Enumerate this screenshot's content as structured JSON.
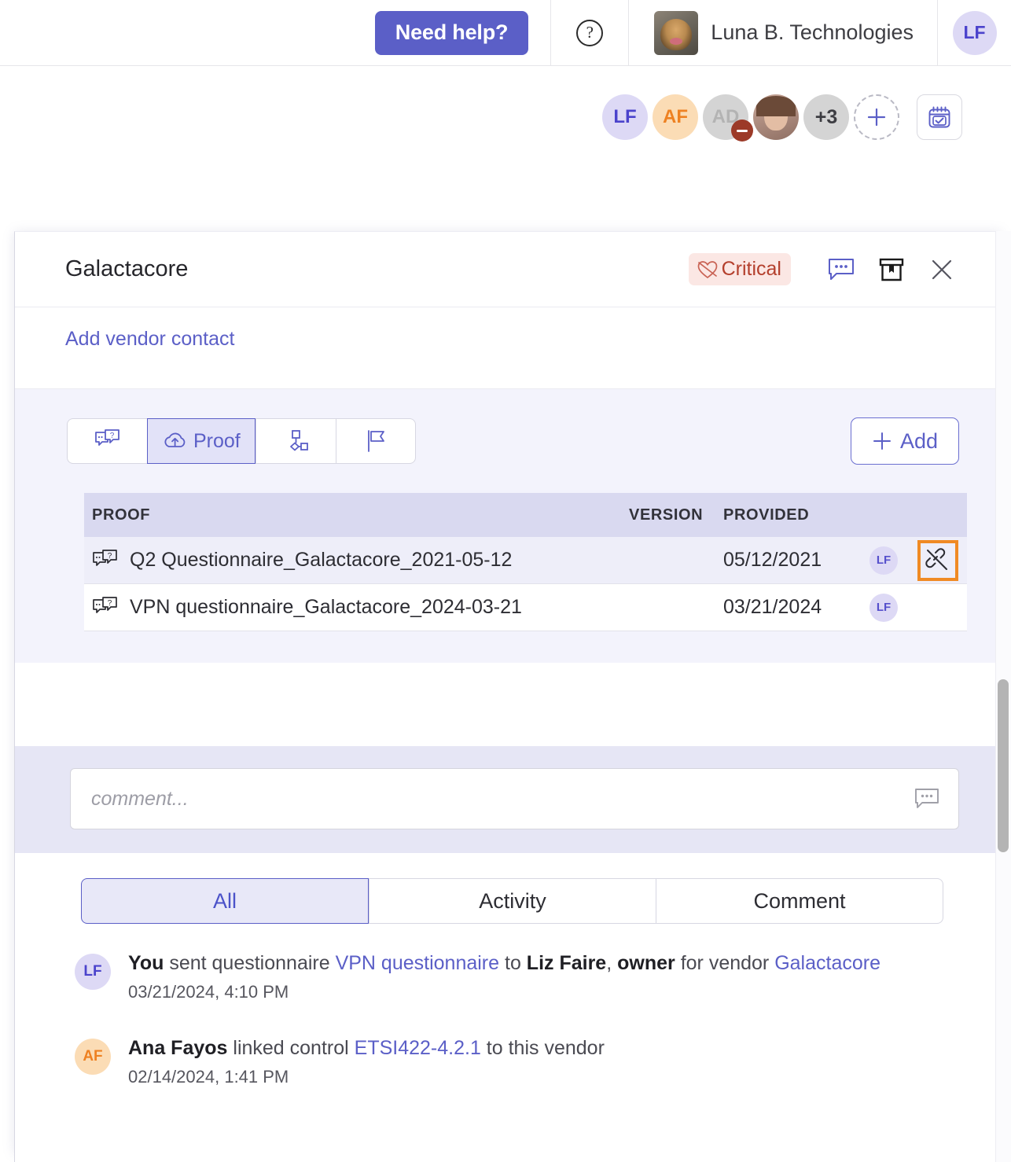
{
  "topbar": {
    "need_help_label": "Need help?",
    "help_icon": "question-circle-icon",
    "org_name": "Luna B. Technologies",
    "user_initials": "LF"
  },
  "assignees": {
    "items": [
      {
        "initials": "LF",
        "type": "initials"
      },
      {
        "initials": "AF",
        "type": "initials"
      },
      {
        "initials": "AD",
        "type": "initials",
        "badge": "minus"
      },
      {
        "initials": "",
        "type": "photo"
      },
      {
        "initials": "+3",
        "type": "overflow"
      }
    ],
    "add_label": "+",
    "calendar_button_icon": "calendar-check-icon"
  },
  "panel": {
    "title": "Galactacore",
    "badge": {
      "label": "Critical",
      "icon": "broken-heart-icon",
      "color": "#b43f2c",
      "bg": "#fbe7e4"
    },
    "actions": [
      {
        "name": "comment-icon"
      },
      {
        "name": "archive-icon"
      },
      {
        "name": "close-icon"
      }
    ],
    "add_vendor_contact": "Add vendor contact"
  },
  "proof": {
    "tabs": [
      {
        "id": "questionnaire",
        "icon": "questionnaire-icon",
        "label": "",
        "active": false
      },
      {
        "id": "proof",
        "icon": "cloud-upload-icon",
        "label": "Proof",
        "active": true
      },
      {
        "id": "workflow",
        "icon": "hierarchy-icon",
        "label": "",
        "active": false
      },
      {
        "id": "flag",
        "icon": "flag-icon",
        "label": "",
        "active": false
      }
    ],
    "add_button": {
      "label": "Add",
      "icon": "plus-icon"
    },
    "columns": [
      "PROOF",
      "VERSION",
      "PROVIDED",
      "",
      ""
    ],
    "rows": [
      {
        "name": "Q2 Questionnaire_Galactacore_2021-05-12",
        "version": "",
        "provided": "05/12/2021",
        "avatar": "LF",
        "action_icon": "unlink-icon",
        "highlighted": true,
        "selected": true
      },
      {
        "name": "VPN questionnaire_Galactacore_2024-03-21",
        "version": "",
        "provided": "03/21/2024",
        "avatar": "LF",
        "action_icon": "",
        "highlighted": false,
        "selected": false
      }
    ]
  },
  "comment": {
    "placeholder": "comment...",
    "value": "",
    "icon": "comment-bubble-icon"
  },
  "feed_tabs": [
    {
      "label": "All",
      "active": true
    },
    {
      "label": "Activity",
      "active": false
    },
    {
      "label": "Comment",
      "active": false
    }
  ],
  "feed": [
    {
      "avatar": "LF",
      "avatar_style": "lf",
      "parts": [
        {
          "t": "You",
          "s": "bold"
        },
        {
          "t": " sent questionnaire ",
          "s": "plain"
        },
        {
          "t": "VPN questionnaire",
          "s": "link"
        },
        {
          "t": " to ",
          "s": "plain"
        },
        {
          "t": "Liz Faire",
          "s": "bold"
        },
        {
          "t": ", ",
          "s": "plain"
        },
        {
          "t": "owner",
          "s": "bold"
        },
        {
          "t": " for vendor ",
          "s": "plain"
        },
        {
          "t": "Galactacore",
          "s": "link"
        }
      ],
      "time": "03/21/2024, 4:10 PM"
    },
    {
      "avatar": "AF",
      "avatar_style": "af",
      "parts": [
        {
          "t": "Ana Fayos",
          "s": "bold"
        },
        {
          "t": " linked control ",
          "s": "plain"
        },
        {
          "t": "ETSI422-4.2.1",
          "s": "link"
        },
        {
          "t": " to this vendor",
          "s": "plain"
        }
      ],
      "time": "02/14/2024, 1:41 PM"
    }
  ],
  "colors": {
    "brand": "#5b5fc7",
    "highlight": "#f08a24",
    "panel_section_bg": "#f3f3fc",
    "comment_bg": "#e6e6f5"
  }
}
